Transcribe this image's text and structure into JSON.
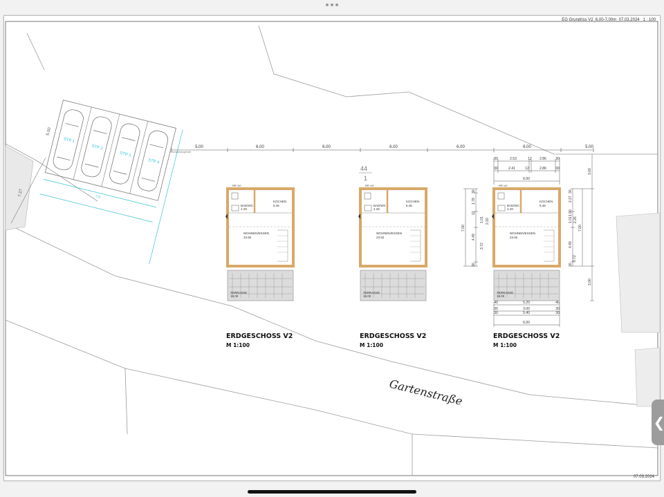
{
  "document": {
    "title_block": "EG Grundriss V2_6,00-7,00m_07.03.2024   1 : 100",
    "date": "07.03.2024",
    "street_name": "Gartenstraße"
  },
  "parking": {
    "labels": [
      "STP 1",
      "STP 2",
      "STP 3",
      "STP 4"
    ],
    "dim_depth": "5.00",
    "dim_width": "2.5",
    "dim_side": "7.27",
    "boundary_label": "Grundstücksgrenze"
  },
  "plans": [
    {
      "caption_title": "ERDGESCHOSS V2",
      "caption_scale": "M 1:100",
      "bad_label": "BAD/WC",
      "bad_area": "4.29",
      "kochen_label": "KOCHEN",
      "kochen_area": "5.46",
      "wohnen_label": "WOHNEN/ESSEN",
      "wohnen_area": "23.92",
      "terrasse_label": "TERRASSE",
      "terrasse_area": "18.00",
      "room_tag": "RR 1/0"
    },
    {
      "caption_title": "ERDGESCHOSS V2",
      "caption_scale": "M 1:100",
      "bad_label": "BAD/WC",
      "bad_area": "4.29",
      "kochen_label": "KOCHEN",
      "kochen_area": "5.46",
      "wohnen_label": "WOHNEN/ESSEN",
      "wohnen_area": "23.92",
      "terrasse_label": "TERRASSE",
      "terrasse_area": "18.00",
      "room_tag": "RR 1/0",
      "stamp_top": "44",
      "stamp_bottom": "1"
    },
    {
      "caption_title": "ERDGESCHOSS V2",
      "caption_scale": "M 1:100",
      "bad_label": "BAD/WC",
      "bad_area": "4.29",
      "kochen_label": "KOCHEN",
      "kochen_area": "5.46",
      "wohnen_label": "WOHNEN/ESSEN",
      "wohnen_area": "23.92",
      "terrasse_label": "TERRASSE",
      "terrasse_area": "18.00",
      "room_tag": "RR 1/0"
    }
  ],
  "top_dimensions": [
    "5.00",
    "6.00",
    "6.00",
    "6.00",
    "6.00",
    "6.00",
    "5.00"
  ],
  "plan3_dimensions": {
    "row1": [
      "30",
      "2.53",
      "12",
      "2.86",
      "30"
    ],
    "row2": [
      "30",
      "2.41",
      "12",
      "2.86",
      "30"
    ],
    "overall": "6.00",
    "left_col": [
      "30",
      "1.78",
      "12",
      "1.01",
      "2.20",
      "4.49",
      "3.72",
      "30"
    ],
    "left_total": "7.00",
    "right_col": [
      "2.27",
      "1.90",
      "1.01",
      "2.26",
      "4.49",
      "3.72",
      "30",
      "30"
    ],
    "right_total": "7.00",
    "right_outer": [
      "3.00",
      "3.00"
    ],
    "bottom_row1": [
      "40",
      "5.20",
      "40"
    ],
    "bottom_row2": [
      "30",
      "3.00",
      "30"
    ],
    "bottom_row3": [
      "30",
      "5.40",
      "30"
    ],
    "bottom_overall": "6.00"
  },
  "colors": {
    "wall": "#d9a868",
    "line": "#7a7a7a",
    "parking": "#39c3d8",
    "hatch": "#c9c9c9"
  },
  "ui": {
    "side_tab_icon": "chevron-left-icon",
    "drag_handle_icon": "drag-handle-icon"
  }
}
